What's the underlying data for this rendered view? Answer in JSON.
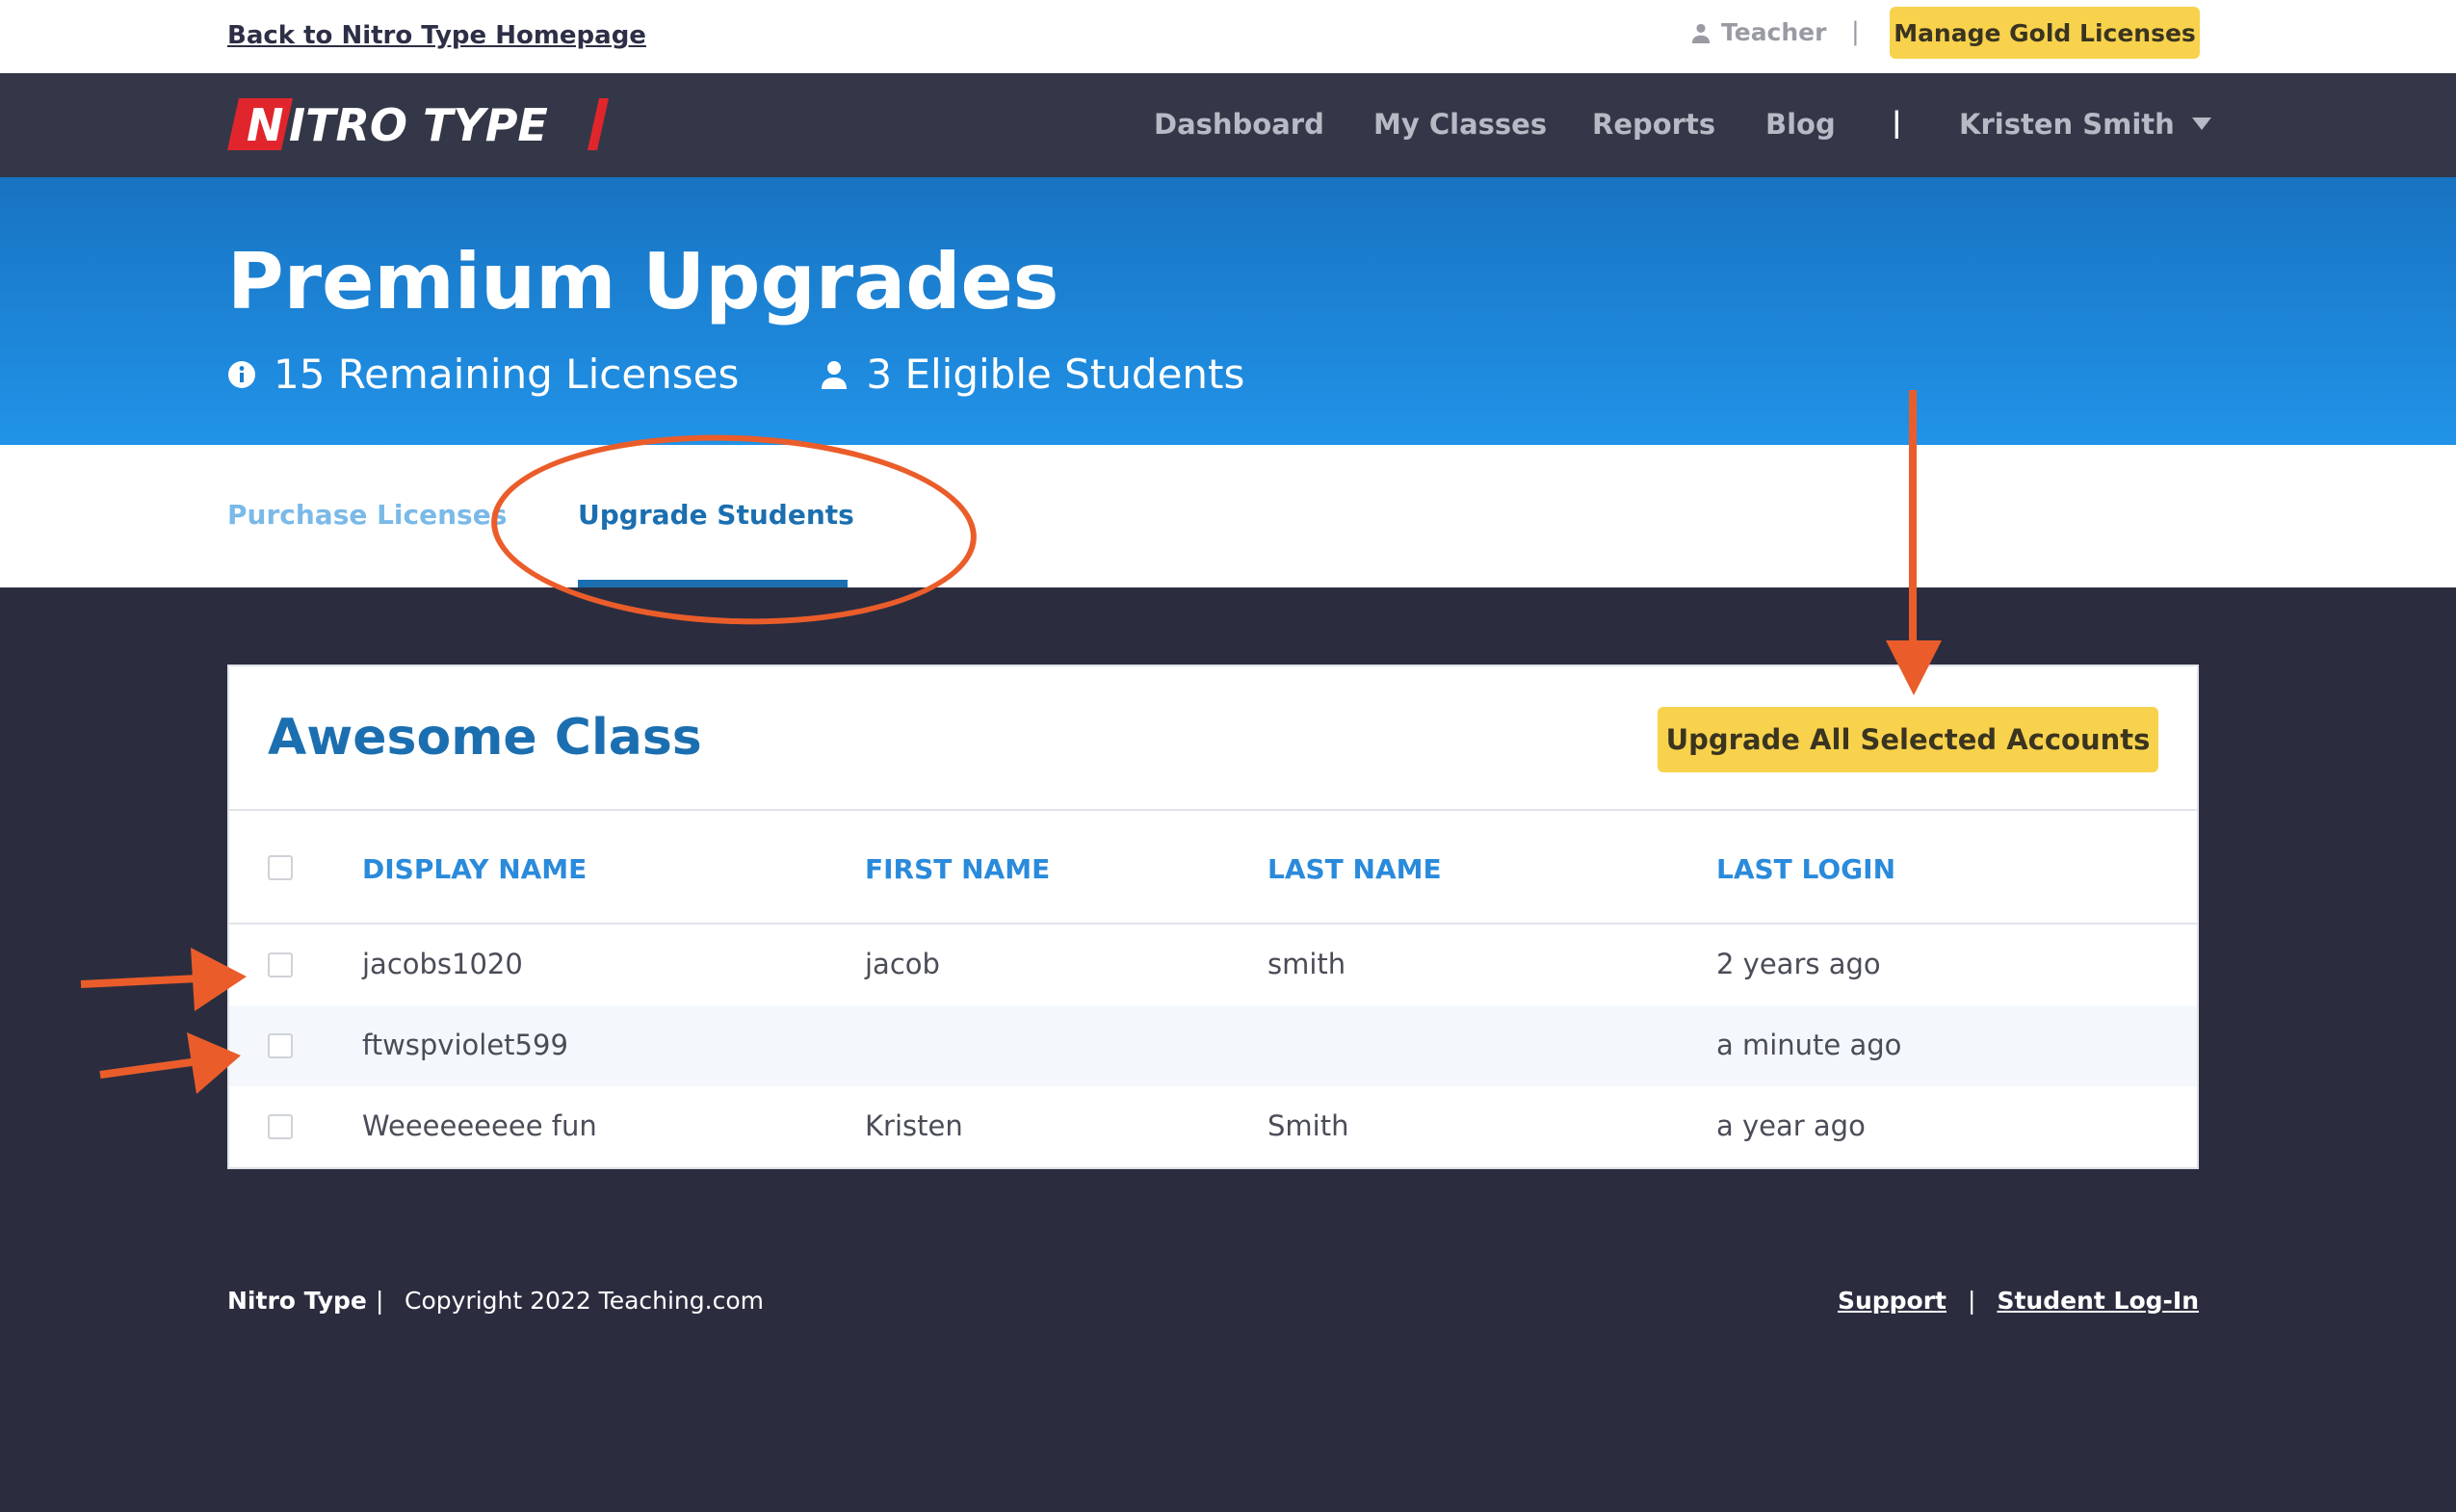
{
  "utility_bar": {
    "back_link": "Back to Nitro Type Homepage",
    "role_label": "Teacher",
    "separator": "|",
    "manage_gold_label": "Manage Gold Licenses"
  },
  "navbar": {
    "logo_text": "NITRO TYPE",
    "items": [
      "Dashboard",
      "My Classes",
      "Reports",
      "Blog"
    ],
    "separator": "|",
    "user_name": "Kristen Smith"
  },
  "hero": {
    "title": "Premium Upgrades",
    "remaining_licenses": "15 Remaining Licenses",
    "eligible_students": "3 Eligible Students"
  },
  "tabs": [
    {
      "label": "Purchase Licenses",
      "active": false
    },
    {
      "label": "Upgrade Students",
      "active": true
    }
  ],
  "class_panel": {
    "title": "Awesome Class",
    "upgrade_all_label": "Upgrade All Selected Accounts",
    "columns": [
      "DISPLAY NAME",
      "FIRST NAME",
      "LAST NAME",
      "LAST LOGIN"
    ],
    "rows": [
      {
        "display_name": "jacobs1020",
        "first_name": "jacob",
        "last_name": "smith",
        "last_login": "2 years ago"
      },
      {
        "display_name": "ftwspviolet599",
        "first_name": "",
        "last_name": "",
        "last_login": "a minute ago"
      },
      {
        "display_name": "Weeeeeeeee fun",
        "first_name": "Kristen",
        "last_name": "Smith",
        "last_login": "a year ago"
      }
    ]
  },
  "footer": {
    "brand": "Nitro Type",
    "separator": "|",
    "copyright": "Copyright 2022 Teaching.com",
    "links": [
      "Support",
      "Student Log-In"
    ]
  },
  "colors": {
    "accent_blue": "#1b6fb0",
    "gold_button": "#f8d24c",
    "annotation_orange": "#ea5d2a",
    "navbar_bg": "#343747"
  }
}
